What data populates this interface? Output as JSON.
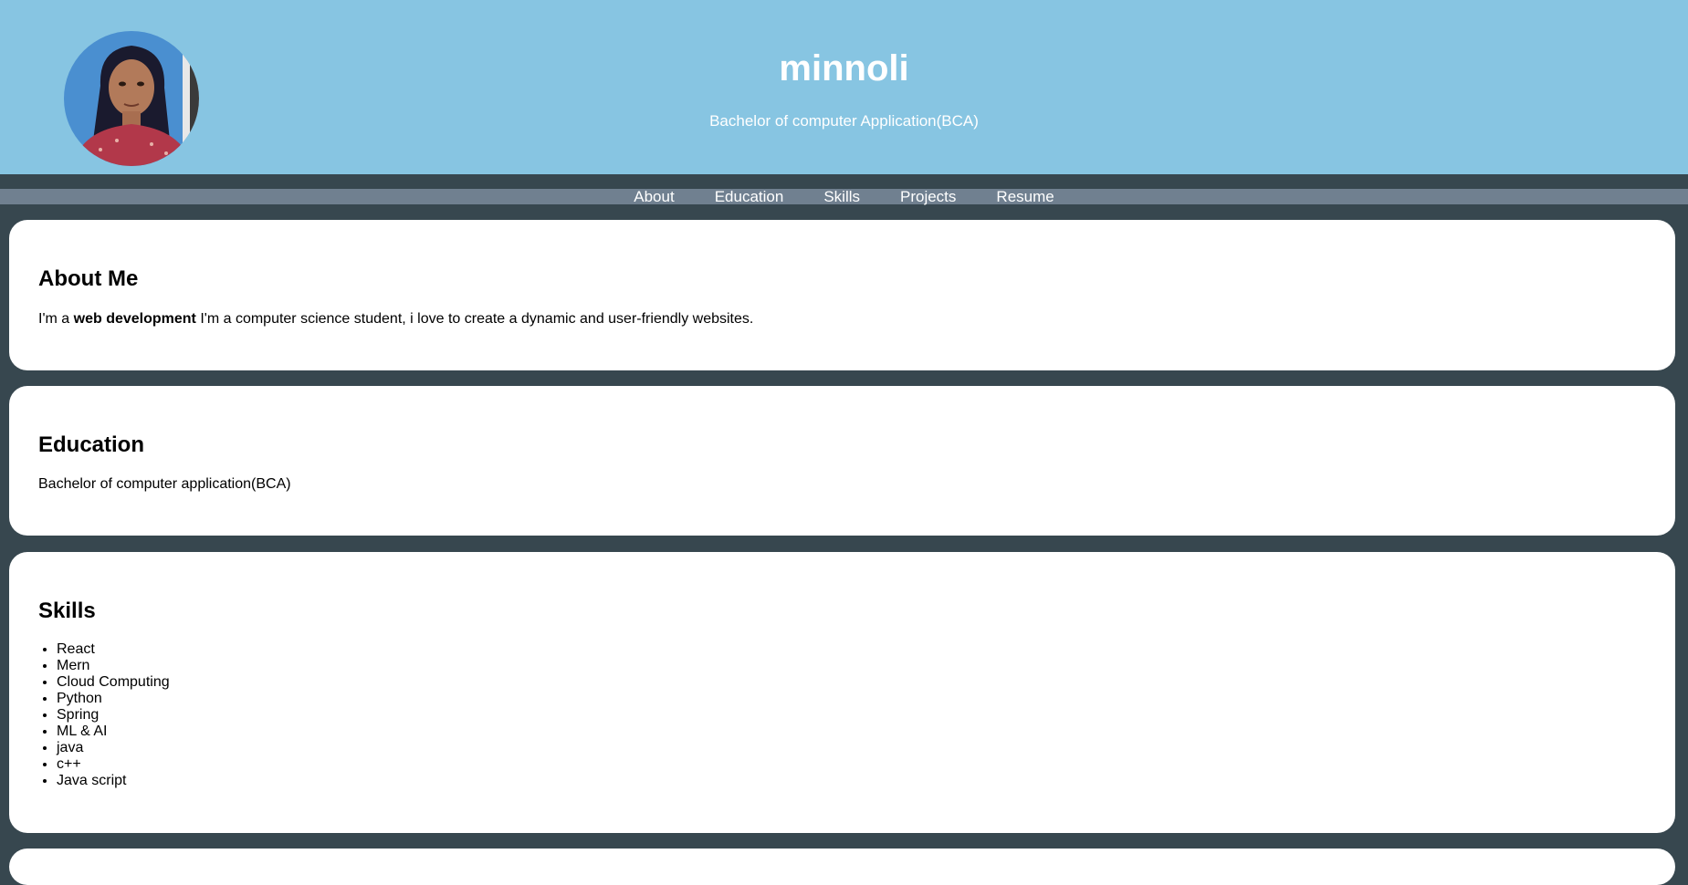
{
  "header": {
    "name": "minnoli",
    "subtitle": "Bachelor of computer Application(BCA)"
  },
  "nav": {
    "items": [
      "About",
      "Education",
      "Skills",
      "Projects",
      "Resume"
    ]
  },
  "about": {
    "heading": "About Me",
    "prefix": "I'm a ",
    "highlight": "web development",
    "suffix": " I'm a computer science student, i love to create a dynamic and user-friendly websites."
  },
  "education": {
    "heading": "Education",
    "text": "Bachelor of computer application(BCA)"
  },
  "skills": {
    "heading": "Skills",
    "items": [
      "React",
      "Mern",
      "Cloud Computing",
      "Python",
      "Spring",
      "ML & AI",
      "java",
      "c++",
      "Java script"
    ]
  },
  "colors": {
    "header_bg": "#87c5e2",
    "page_bg": "#37474f",
    "nav_bg": "#708090",
    "card_bg": "#ffffff"
  }
}
